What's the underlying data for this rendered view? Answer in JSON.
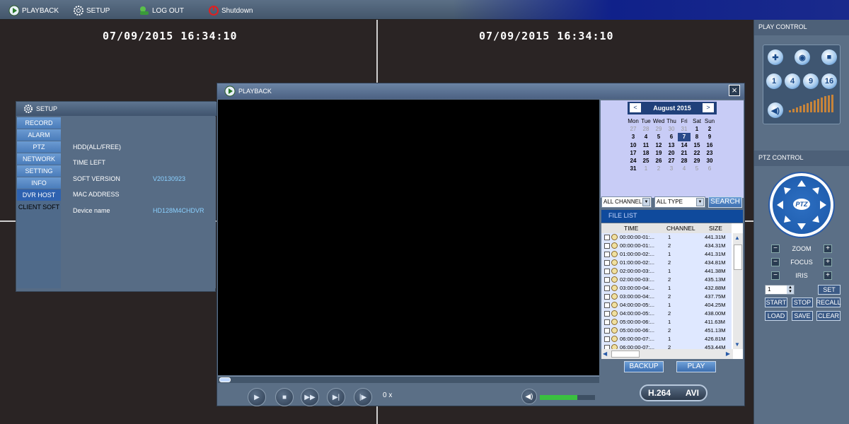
{
  "topbar": {
    "items": [
      {
        "label": "PLAYBACK",
        "icon": "playback-icon"
      },
      {
        "label": "SETUP",
        "icon": "gear-icon"
      },
      {
        "label": "LOG OUT",
        "icon": "logout-icon"
      },
      {
        "label": "Shutdown",
        "icon": "power-icon"
      }
    ]
  },
  "video": {
    "osd_left": "07/09/2015  16:34:10",
    "osd_right": "07/09/2015  16:34:10"
  },
  "setup": {
    "title": "SETUP",
    "menu": [
      "RECORD",
      "ALARM",
      "PTZ",
      "NETWORK",
      "SETTING",
      "INFO",
      "DVR HOST",
      "CLIENT SOFT"
    ],
    "selected_menu": "DVR HOST",
    "rows": [
      {
        "label": "HDD(ALL/FREE)",
        "value": ""
      },
      {
        "label": "TIME LEFT",
        "value": ""
      },
      {
        "label": "SOFT VERSION",
        "value": "V20130923"
      },
      {
        "label": "MAC ADDRESS",
        "value": ""
      },
      {
        "label": "Device name",
        "value": "HD128M4CHDVR"
      }
    ]
  },
  "playback": {
    "title": "PLAYBACK",
    "calendar": {
      "month_label": "August 2015",
      "prev": "<",
      "next": ">",
      "days_of_week": [
        "Mon",
        "Tue",
        "Wed",
        "Thu",
        "Fri",
        "Sat",
        "Sun"
      ],
      "leading_days": [
        "27",
        "28",
        "29",
        "30",
        "31"
      ],
      "days": [
        "1",
        "2",
        "3",
        "4",
        "5",
        "6",
        "7",
        "8",
        "9",
        "10",
        "11",
        "12",
        "13",
        "14",
        "15",
        "16",
        "17",
        "18",
        "19",
        "20",
        "21",
        "22",
        "23",
        "24",
        "25",
        "26",
        "27",
        "28",
        "29",
        "30",
        "31"
      ],
      "trailing_days": [
        "1",
        "2",
        "3",
        "4",
        "5",
        "6"
      ],
      "selected_day": "7"
    },
    "channel_select": "ALL CHANNEL",
    "type_select": "ALL TYPE",
    "search_label": "SEARCH",
    "file_list": {
      "title": "FILE LIST",
      "columns": [
        "TIME",
        "CHANNEL",
        "SIZE"
      ],
      "rows": [
        {
          "time": "00:00:00-01:...",
          "channel": "1",
          "size": "441.31M"
        },
        {
          "time": "00:00:00-01:...",
          "channel": "2",
          "size": "434.31M"
        },
        {
          "time": "01:00:00-02:...",
          "channel": "1",
          "size": "441.31M"
        },
        {
          "time": "01:00:00-02:...",
          "channel": "2",
          "size": "434.81M"
        },
        {
          "time": "02:00:00-03:...",
          "channel": "1",
          "size": "441.38M"
        },
        {
          "time": "02:00:00-03:...",
          "channel": "2",
          "size": "435.13M"
        },
        {
          "time": "03:00:00-04:...",
          "channel": "1",
          "size": "432.88M"
        },
        {
          "time": "03:00:00-04:...",
          "channel": "2",
          "size": "437.75M"
        },
        {
          "time": "04:00:00-05:...",
          "channel": "1",
          "size": "404.25M"
        },
        {
          "time": "04:00:00-05:...",
          "channel": "2",
          "size": "438.00M"
        },
        {
          "time": "05:00:00-06:...",
          "channel": "1",
          "size": "411.63M"
        },
        {
          "time": "05:00:00-06:...",
          "channel": "2",
          "size": "451.13M"
        },
        {
          "time": "06:00:00-07:...",
          "channel": "1",
          "size": "426.81M"
        },
        {
          "time": "06:00:00-07:...",
          "channel": "2",
          "size": "453.44M"
        }
      ]
    },
    "backup_label": "BACKUP",
    "play_label": "PLAY",
    "speed": "0 x",
    "volume_level": 0.68,
    "format_left": "H.264",
    "format_right": "AVI"
  },
  "play_control": {
    "title": "PLAY CONTROL",
    "row1": [
      "grid-icon",
      "capture-icon",
      "record-icon"
    ],
    "row2": [
      "1",
      "4",
      "9",
      "16"
    ]
  },
  "ptz_control": {
    "title": "PTZ CONTROL",
    "center_label": "PTZ",
    "zoom_label": "ZOOM",
    "focus_label": "FOCUS",
    "iris_label": "IRIS",
    "preset_value": "1",
    "set_label": "SET",
    "start_label": "START",
    "stop_label": "STOP",
    "recall_label": "RECALL",
    "load_label": "LOAD",
    "save_label": "SAVE",
    "clear_label": "CLEAR"
  },
  "colors": {
    "panel": "#5b6f86",
    "accent_blue": "#0f4a9c",
    "calendar_bg": "#c8ccf6",
    "volume_green": "#3ac040"
  }
}
